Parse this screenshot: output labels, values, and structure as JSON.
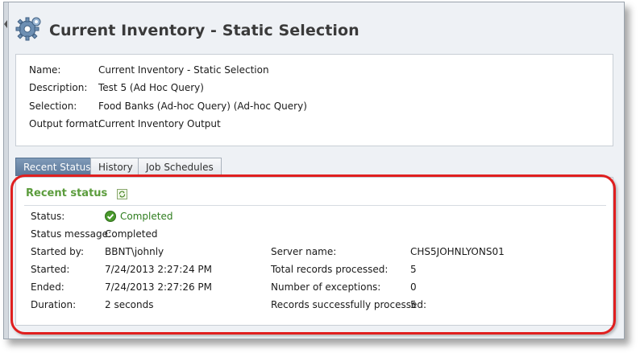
{
  "page": {
    "title": "Current Inventory - Static Selection"
  },
  "info": {
    "rows": [
      {
        "label": "Name:",
        "value": "Current Inventory - Static Selection"
      },
      {
        "label": "Description:",
        "value": "Test 5 (Ad Hoc Query)"
      },
      {
        "label": "Selection:",
        "value": "Food Banks (Ad-hoc Query) (Ad-hoc Query)"
      },
      {
        "label": "Output format:",
        "value": "Current Inventory Output"
      }
    ]
  },
  "tabs": [
    {
      "label": "Recent Status",
      "active": true
    },
    {
      "label": "History",
      "active": false
    },
    {
      "label": "Job Schedules",
      "active": false
    }
  ],
  "recent_status": {
    "title": "Recent status",
    "status_label": "Status:",
    "status_value": "Completed",
    "status_message_label": "Status message:",
    "status_message_value": "Completed",
    "started_by_label": "Started by:",
    "started_by_value": "BBNT\\johnly",
    "started_label": "Started:",
    "started_value": "7/24/2013 2:27:24 PM",
    "ended_label": "Ended:",
    "ended_value": "7/24/2013 2:27:26 PM",
    "duration_label": "Duration:",
    "duration_value": "2 seconds",
    "server_name_label": "Server name:",
    "server_name_value": "CHS5JOHNLYONS01",
    "total_records_label": "Total records processed:",
    "total_records_value": "5",
    "exceptions_label": "Number of exceptions:",
    "exceptions_value": "0",
    "success_label": "Records successfully processed:",
    "success_value": "5"
  },
  "colors": {
    "accent_green": "#5b9c3c",
    "tab_active": "#5b7799",
    "highlight_red": "#e01f1f"
  },
  "icons": {
    "page": "gear-icon",
    "refresh": "refresh-icon",
    "status": "check-circle-icon"
  }
}
